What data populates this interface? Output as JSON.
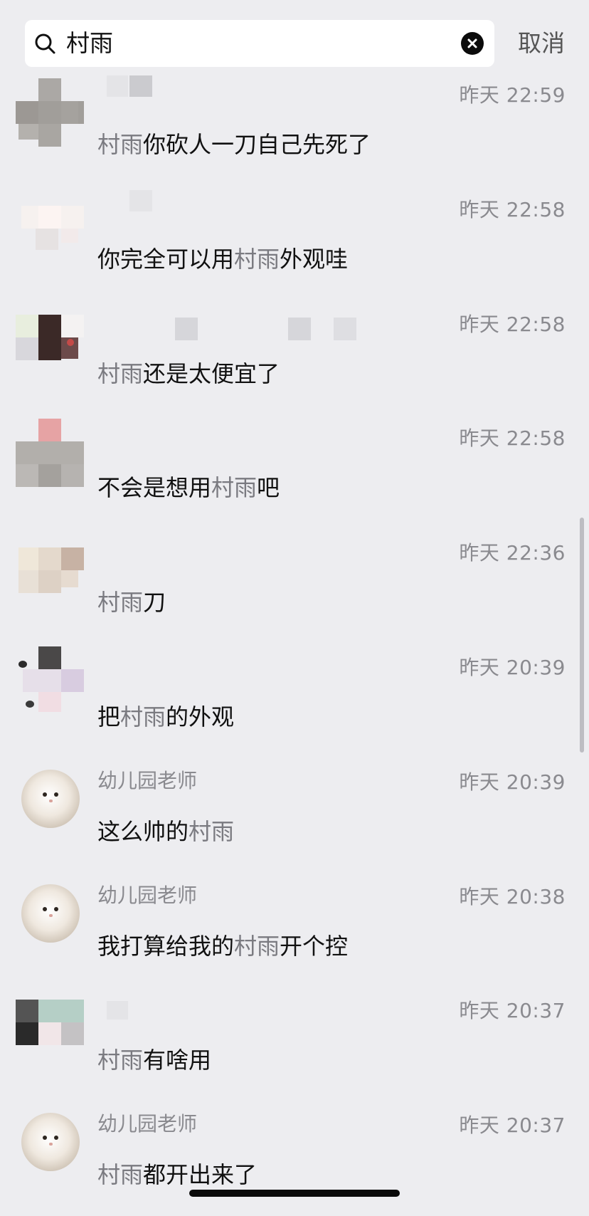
{
  "search": {
    "query": "村雨",
    "cancel_label": "取消"
  },
  "results": [
    {
      "sender": "",
      "time": "昨天 22:59",
      "before": "",
      "hl": "村雨",
      "after": "你砍人一刀自己先死了",
      "avatar": "mosaic-grey"
    },
    {
      "sender": "",
      "time": "昨天 22:58",
      "before": "你完全可以用",
      "hl": "村雨",
      "after": "外观哇",
      "avatar": "mosaic-light"
    },
    {
      "sender": "",
      "time": "昨天 22:58",
      "before": "",
      "hl": "村雨",
      "after": "还是太便宜了",
      "avatar": "mosaic-dark"
    },
    {
      "sender": "",
      "time": "昨天 22:58",
      "before": "不会是想用",
      "hl": "村雨",
      "after": "吧",
      "avatar": "mosaic-pink-grey"
    },
    {
      "sender": "",
      "time": "昨天 22:36",
      "before": "",
      "hl": "村雨",
      "after": "刀",
      "avatar": "mosaic-beige"
    },
    {
      "sender": "",
      "time": "昨天 20:39",
      "before": "把",
      "hl": "村雨",
      "after": "的外观",
      "avatar": "mosaic-lilac"
    },
    {
      "sender": "幼儿园老师",
      "time": "昨天 20:39",
      "before": "这么帅的",
      "hl": "村雨",
      "after": "",
      "avatar": "cat"
    },
    {
      "sender": "幼儿园老师",
      "time": "昨天 20:38",
      "before": "我打算给我的",
      "hl": "村雨",
      "after": "开个控",
      "avatar": "cat"
    },
    {
      "sender": "",
      "time": "昨天 20:37",
      "before": "",
      "hl": "村雨",
      "after": "有啥用",
      "avatar": "mosaic-teal"
    },
    {
      "sender": "幼儿园老师",
      "time": "昨天 20:37",
      "before": "",
      "hl": "村雨",
      "after": "都开出来了",
      "avatar": "cat"
    }
  ],
  "colors": {
    "background": "#ededf0",
    "highlight_text": "#7a7a80",
    "secondary_text": "#8a8a8f"
  }
}
